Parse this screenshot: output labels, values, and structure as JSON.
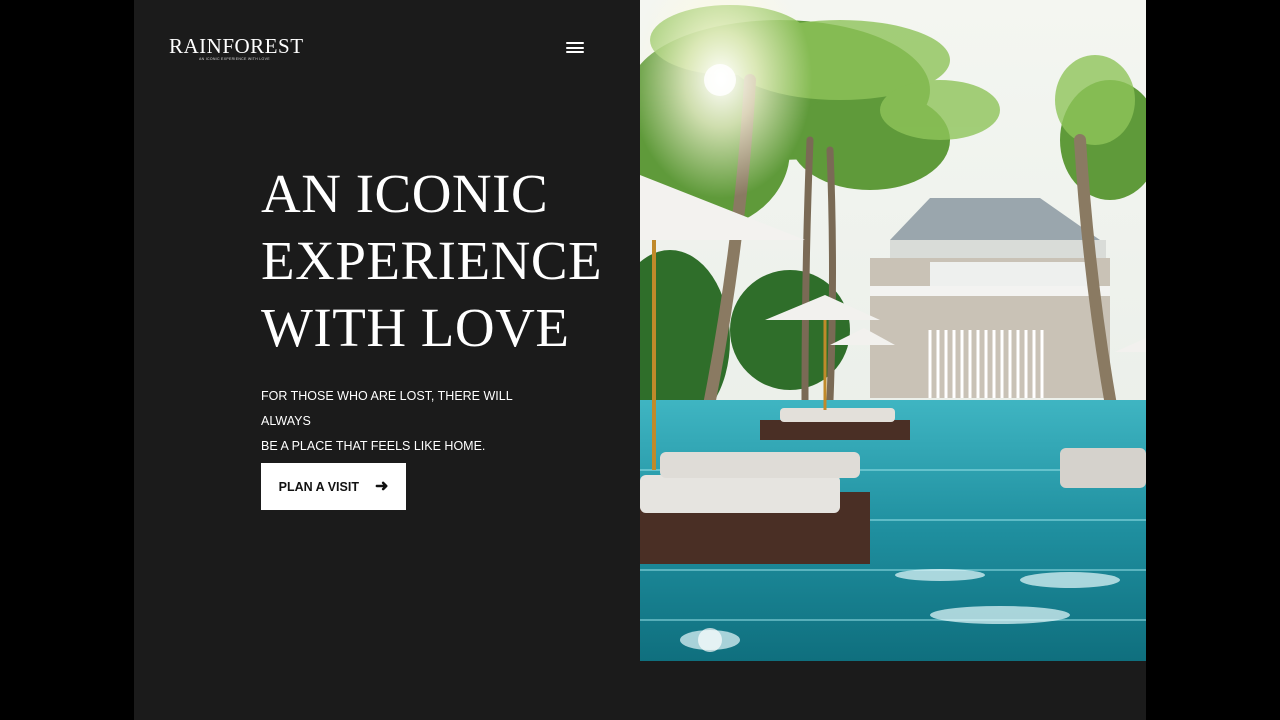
{
  "brand": {
    "name": "RAINFOREST",
    "tagline": "AN ICONIC EXPERIENCE WITH LOVE"
  },
  "nav": {
    "menu_icon": "hamburger-menu-icon"
  },
  "hero": {
    "headline_lines": [
      "AN ICONIC",
      "EXPERIENCE",
      "WITH LOVE"
    ],
    "subtext_lines": [
      "FOR THOSE WHO ARE LOST, THERE WILL ALWAYS",
      "BE A PLACE THAT FEELS LIKE HOME."
    ],
    "cta_label": "PLAN A VISIT",
    "cta_icon": "arrow-right-icon",
    "image_subject": "tropical resort pool with palm trees and umbrellas"
  },
  "colors": {
    "page_background": "#1b1b1b",
    "outer_background": "#000000",
    "text": "#ffffff",
    "button_background": "#ffffff",
    "button_text": "#111111"
  }
}
